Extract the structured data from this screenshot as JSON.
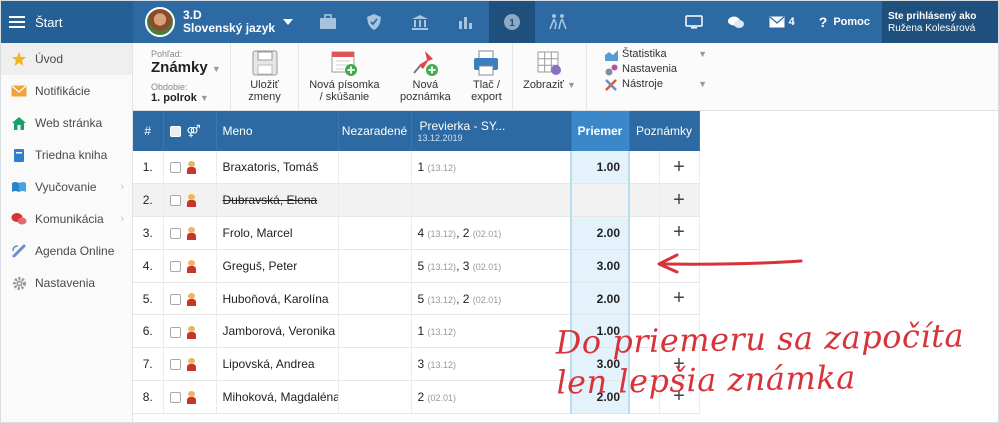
{
  "topbar": {
    "start_label": "Štart",
    "class_name": "3.D",
    "subject": "Slovenský jazyk",
    "messages_count": "4",
    "help_label": "Pomoc",
    "user_line1": "Ste prihlásený ako",
    "user_line2": "Ružena Kolesárová"
  },
  "sidebar": {
    "items": [
      {
        "label": "Úvod",
        "icon": "star-icon"
      },
      {
        "label": "Notifikácie",
        "icon": "envelope-icon"
      },
      {
        "label": "Web stránka",
        "icon": "home-icon"
      },
      {
        "label": "Triedna kniha",
        "icon": "book-icon"
      },
      {
        "label": "Vyučovanie",
        "icon": "open-book-icon"
      },
      {
        "label": "Komunikácia",
        "icon": "chat-icon"
      },
      {
        "label": "Agenda Online",
        "icon": "link-icon"
      },
      {
        "label": "Nastavenia",
        "icon": "gear-icon"
      }
    ]
  },
  "toolbar": {
    "view_label": "Pohľad:",
    "view_value": "Známky",
    "period_label": "Obdobie:",
    "period_value": "1. polrok",
    "save_line1": "Uložiť",
    "save_line2": "zmeny",
    "new_test_line1": "Nová písomka",
    "new_test_line2": "/ skúšanie",
    "new_note_line1": "Nová",
    "new_note_line2": "poznámka",
    "print_line1": "Tlač /",
    "print_line2": "export",
    "show_label": "Zobraziť",
    "menu_statistics": "Štatistika",
    "menu_settings": "Nastavenia",
    "menu_tools": "Nástroje"
  },
  "table": {
    "headers": {
      "num": "#",
      "name": "Meno",
      "unsorted": "Nezaradené",
      "test_title": "Previerka - SY...",
      "test_date": "13.12.2019",
      "avg": "Priemer",
      "notes": "Poznámky"
    },
    "rows": [
      {
        "num": "1.",
        "name": "Braxatoris, Tomáš",
        "g1": "1",
        "d1": "(13.12)",
        "g2": "",
        "d2": "",
        "avg": "1.00",
        "plus": "+",
        "disabled": false
      },
      {
        "num": "2.",
        "name": "Dubravská, Elena",
        "g1": "",
        "d1": "",
        "g2": "",
        "d2": "",
        "avg": "",
        "plus": "+",
        "disabled": true
      },
      {
        "num": "3.",
        "name": "Frolo, Marcel",
        "g1": "4",
        "d1": "(13.12)",
        "g2": "2",
        "d2": "(02.01)",
        "avg": "2.00",
        "plus": "+",
        "disabled": false
      },
      {
        "num": "4.",
        "name": "Greguš, Peter",
        "g1": "5",
        "d1": "(13.12)",
        "g2": "3",
        "d2": "(02.01)",
        "avg": "3.00",
        "plus": "",
        "disabled": false
      },
      {
        "num": "5.",
        "name": "Huboňová, Karolína",
        "g1": "5",
        "d1": "(13.12)",
        "g2": "2",
        "d2": "(02.01)",
        "avg": "2.00",
        "plus": "+",
        "disabled": false
      },
      {
        "num": "6.",
        "name": "Jamborová, Veronika",
        "g1": "1",
        "d1": "(13.12)",
        "g2": "",
        "d2": "",
        "avg": "1.00",
        "plus": "",
        "disabled": false
      },
      {
        "num": "7.",
        "name": "Lipovská, Andrea",
        "g1": "3",
        "d1": "(13.12)",
        "g2": "",
        "d2": "",
        "avg": "3.00",
        "plus": "+",
        "disabled": false
      },
      {
        "num": "8.",
        "name": "Mihoková, Magdaléna",
        "g1": "2",
        "d1": "(02.01)",
        "g2": "",
        "d2": "",
        "avg": "2.00",
        "plus": "+",
        "disabled": false
      }
    ]
  },
  "annotation": {
    "line1": "Do priemeru sa započíta",
    "line2": "len lepšia známka",
    "color": "#d6333a"
  }
}
